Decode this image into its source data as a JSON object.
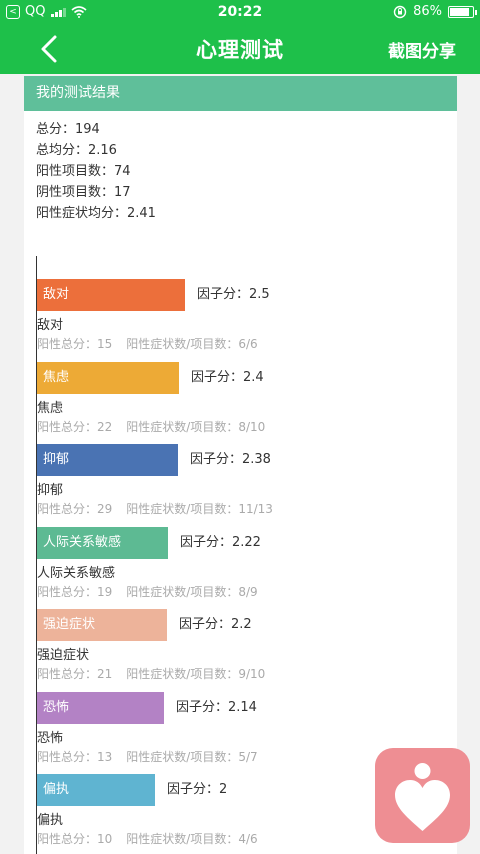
{
  "status_bar": {
    "back_app_glyph": "<",
    "carrier": "QQ",
    "signal_bars": 4,
    "signal_filled": 3,
    "time": "20:22",
    "battery_percent": "86%",
    "battery_level": 0.86
  },
  "nav": {
    "title": "心理测试",
    "action_label": "截图分享",
    "back_icon": "chevron-left-icon"
  },
  "card": {
    "header": "我的测试结果",
    "summary": [
      "总分：194",
      "总均分：2.16",
      "阳性项目数：74",
      "阴性项目数：17",
      "阳性症状均分：2.41"
    ]
  },
  "factor_value_prefix": "因子分：",
  "chart_data": {
    "type": "bar",
    "orientation": "horizontal",
    "xlim": [
      0,
      4
    ],
    "categories": [
      "敌对",
      "焦虑",
      "抑郁",
      "人际关系敏感",
      "强迫症状",
      "恐怖",
      "偏执"
    ],
    "values": [
      2.5,
      2.4,
      2.38,
      2.22,
      2.2,
      2.14,
      2
    ],
    "colors": [
      "#ec6f3b",
      "#edaa36",
      "#4a73b3",
      "#5dba93",
      "#edb39a",
      "#b382c5",
      "#5fb4d1"
    ]
  },
  "factors": [
    {
      "name": "敌对",
      "value": 2.5,
      "value_text": "2.5",
      "detail_total": "阳性总分：15",
      "detail_ratio": "阳性症状数/项目数：6/6"
    },
    {
      "name": "焦虑",
      "value": 2.4,
      "value_text": "2.4",
      "detail_total": "阳性总分：22",
      "detail_ratio": "阳性症状数/项目数：8/10"
    },
    {
      "name": "抑郁",
      "value": 2.38,
      "value_text": "2.38",
      "detail_total": "阳性总分：29",
      "detail_ratio": "阳性症状数/项目数：11/13"
    },
    {
      "name": "人际关系敏感",
      "value": 2.22,
      "value_text": "2.22",
      "detail_total": "阳性总分：19",
      "detail_ratio": "阳性症状数/项目数：8/9"
    },
    {
      "name": "强迫症状",
      "value": 2.2,
      "value_text": "2.2",
      "detail_total": "阳性总分：21",
      "detail_ratio": "阳性症状数/项目数：9/10"
    },
    {
      "name": "恐怖",
      "value": 2.14,
      "value_text": "2.14",
      "detail_total": "阳性总分：13",
      "detail_ratio": "阳性症状数/项目数：5/7"
    },
    {
      "name": "偏执",
      "value": 2,
      "value_text": "2",
      "detail_total": "阳性总分：10",
      "detail_ratio": "阳性症状数/项目数：4/6"
    }
  ],
  "floating_logo": {
    "icon": "heart-person-icon",
    "color": "#ee8e93"
  }
}
